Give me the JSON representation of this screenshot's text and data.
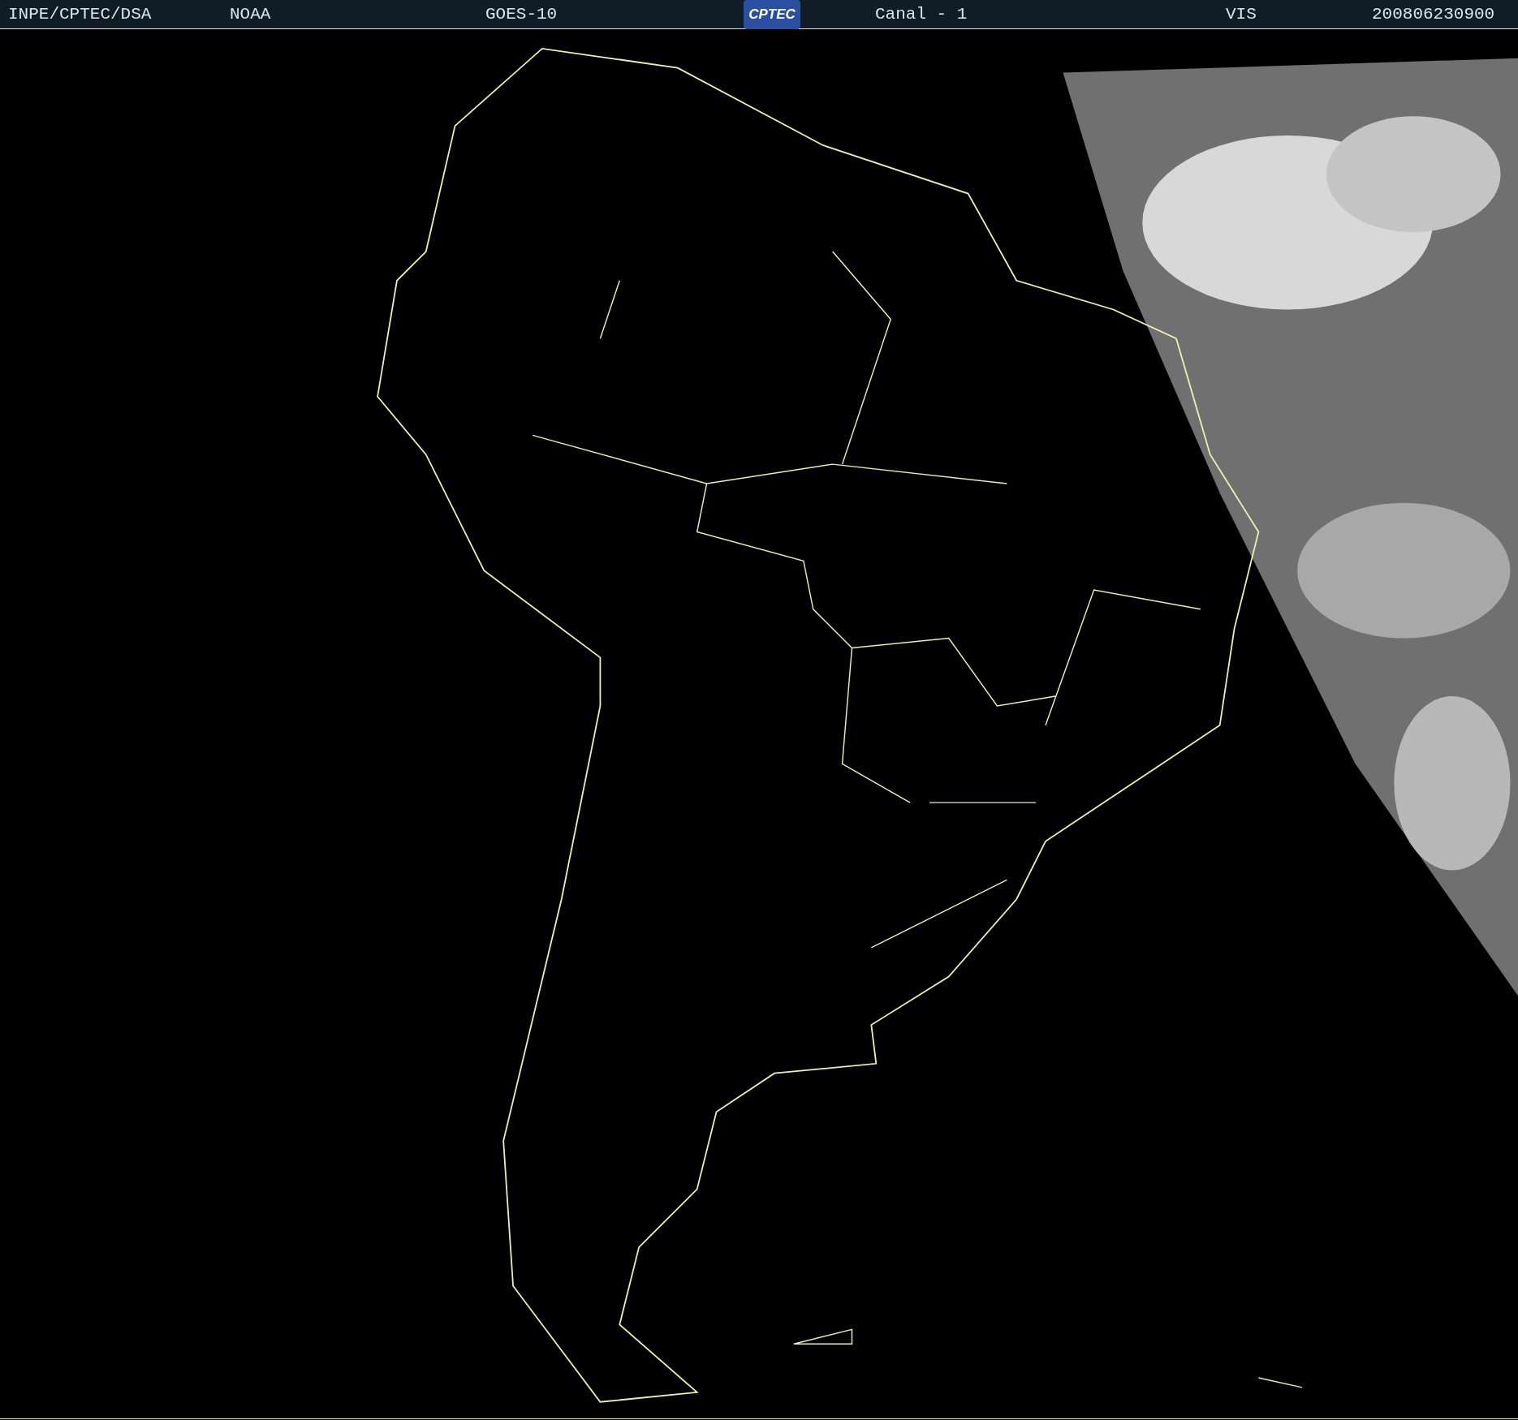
{
  "header": {
    "items": [
      {
        "kind": "text",
        "text": "INPE/CPTEC/DSA"
      },
      {
        "kind": "text",
        "text": "NOAA"
      },
      {
        "kind": "text",
        "text": "GOES-10"
      },
      {
        "kind": "logo",
        "text": "CPTEC"
      },
      {
        "kind": "text",
        "text": "Canal - 1"
      },
      {
        "kind": "text",
        "text": "VIS"
      },
      {
        "kind": "text",
        "text": "200806230900"
      }
    ]
  }
}
